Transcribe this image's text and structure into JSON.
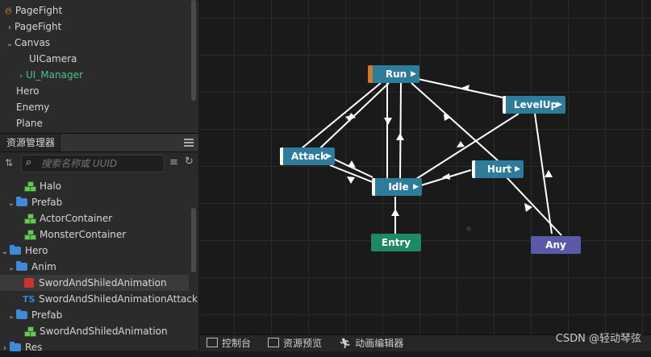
{
  "hierarchy": [
    {
      "label": "PageFight",
      "icon": "fire-icon"
    },
    {
      "label": "PageFight",
      "arrow": ">"
    },
    {
      "label": "Canvas",
      "arrow": "v"
    },
    {
      "label": "UICamera"
    },
    {
      "label": "UI_Manager",
      "arrow": ">",
      "color": "#4fc08d"
    },
    {
      "label": "Hero"
    },
    {
      "label": "Enemy"
    },
    {
      "label": "Plane"
    }
  ],
  "assets_panel": {
    "title": "资源管理器",
    "search_placeholder": "搜索名称或 UUID"
  },
  "assets": [
    {
      "label": "Halo",
      "type": "prefab"
    },
    {
      "label": "Prefab",
      "type": "folder",
      "arrow": "v"
    },
    {
      "label": "ActorContainer",
      "type": "prefab"
    },
    {
      "label": "MonsterContainer",
      "type": "prefab"
    },
    {
      "label": "Hero",
      "type": "folder",
      "arrow": "v"
    },
    {
      "label": "Anim",
      "type": "folder",
      "arrow": "v"
    },
    {
      "label": "SwordAndShiledAnimation",
      "type": "anim"
    },
    {
      "label": "SwordAndShiledAnimationAttack",
      "type": "ts"
    },
    {
      "label": "Prefab",
      "type": "folder",
      "arrow": "v"
    },
    {
      "label": "SwordAndShiledAnimation",
      "type": "prefab"
    },
    {
      "label": "Res",
      "type": "folder",
      "arrow": ">"
    }
  ],
  "graph": {
    "nodes": {
      "run": "Run",
      "levelup": "LevelUp",
      "attack": "Attack",
      "hurt": "Hurt",
      "idle": "Idle",
      "entry": "Entry",
      "any": "Any"
    },
    "colors": {
      "state": "#2e7c9c",
      "entry": "#1d8a63",
      "any": "#5a5aa8",
      "default_marker": "#d07a2a"
    }
  },
  "bottom_tabs": {
    "console": "控制台",
    "preview": "资源预览",
    "anim_editor": "动画编辑器"
  },
  "watermark": "CSDN @轻动琴弦"
}
